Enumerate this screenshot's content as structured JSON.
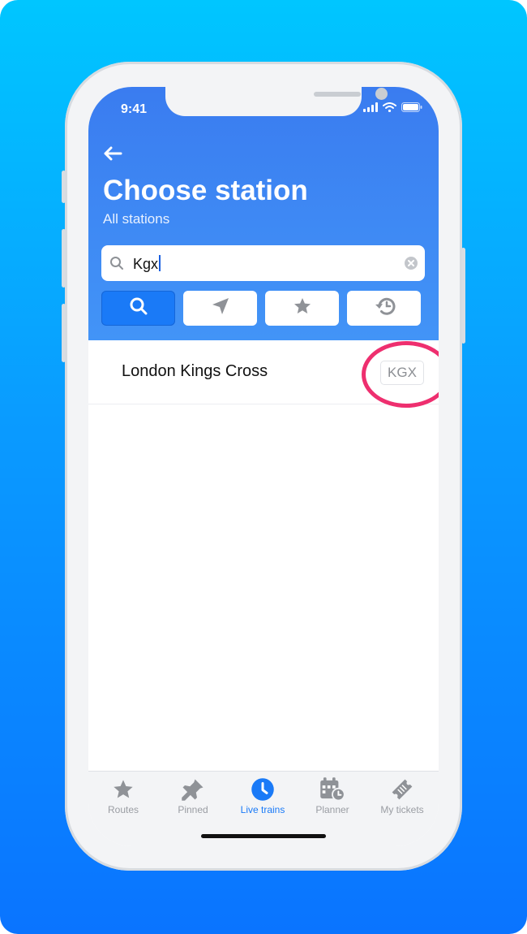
{
  "status_bar": {
    "time": "9:41"
  },
  "header": {
    "title": "Choose station",
    "subtitle": "All stations"
  },
  "search": {
    "value": "Kgx"
  },
  "filters": [
    {
      "icon": "search-icon",
      "active": true
    },
    {
      "icon": "location-arrow-icon",
      "active": false
    },
    {
      "icon": "star-icon",
      "active": false
    },
    {
      "icon": "history-icon",
      "active": false
    }
  ],
  "results": [
    {
      "name": "London Kings Cross",
      "code": "KGX"
    }
  ],
  "tabs": [
    {
      "label": "Routes",
      "icon": "star-icon",
      "active": false
    },
    {
      "label": "Pinned",
      "icon": "pin-icon",
      "active": false
    },
    {
      "label": "Live trains",
      "icon": "clock-icon",
      "active": true
    },
    {
      "label": "Planner",
      "icon": "calendar-icon",
      "active": false
    },
    {
      "label": "My tickets",
      "icon": "ticket-icon",
      "active": false
    }
  ],
  "colors": {
    "header": "#3a7cf0",
    "accent": "#1a7af7",
    "highlight": "#ee2f6f",
    "background_top": "#00c6ff",
    "background_bottom": "#0a74ff"
  }
}
